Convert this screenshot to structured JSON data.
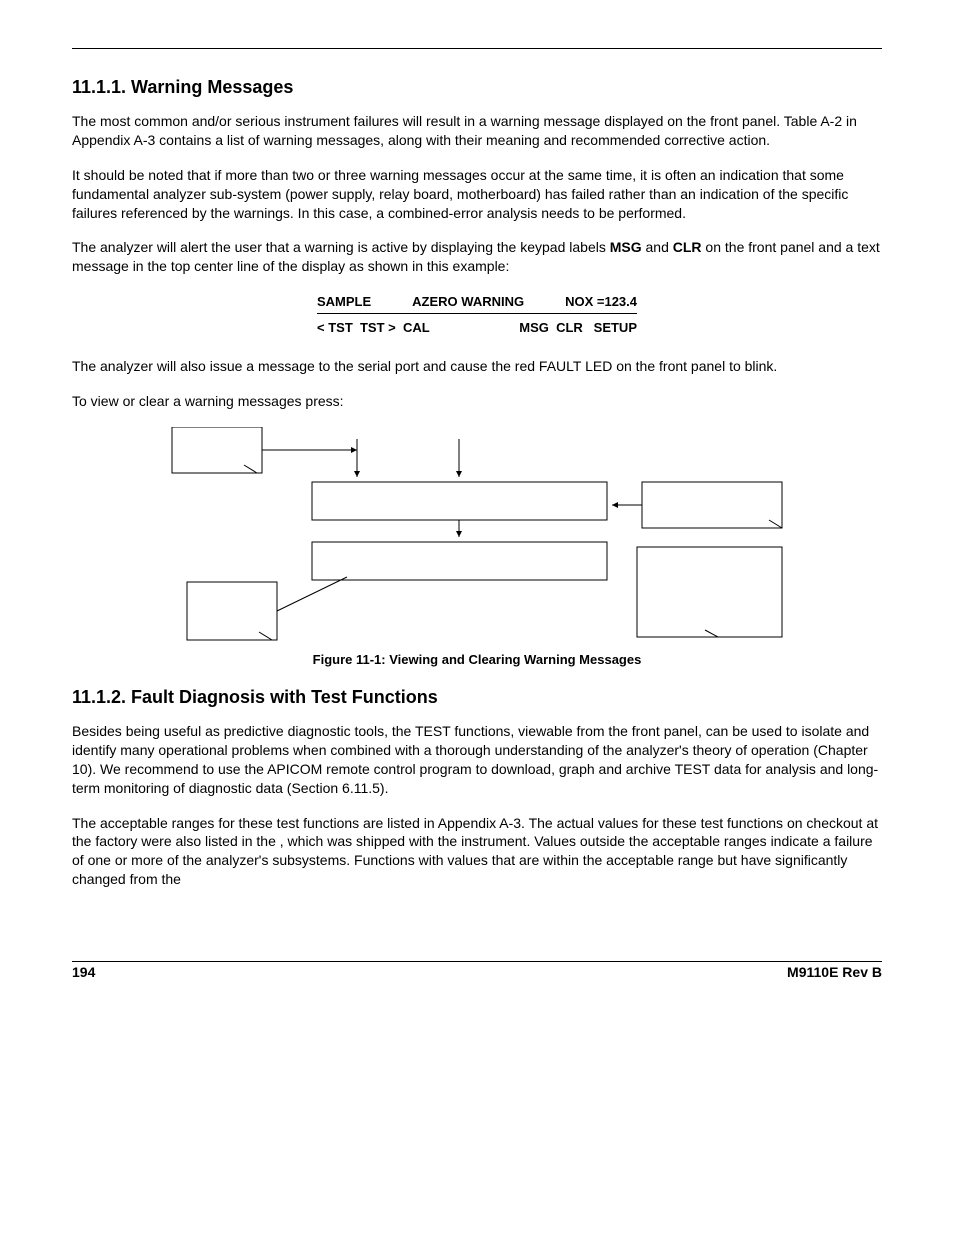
{
  "section1": {
    "heading": "11.1.1. Warning Messages",
    "p1": "The most common and/or serious instrument failures will result in a warning message displayed on the front panel. Table A-2 in Appendix A-3 contains a list of warning messages, along with their meaning and recommended corrective action.",
    "p2": "It should be noted that if more than two or three warning messages occur at the same time, it is often an indication that some fundamental analyzer sub-system (power supply, relay board, motherboard) has failed rather than an indication of the specific failures referenced by the warnings. In this case, a combined-error analysis needs to be performed.",
    "p3_pre": "The analyzer will alert the user that a warning is active by displaying the keypad labels ",
    "p3_b1": "MSG",
    "p3_mid": " and ",
    "p3_b2": "CLR",
    "p3_post": " on the front panel and a text message in the top center line of the display as shown in this example:"
  },
  "display": {
    "row1_left": "SAMPLE",
    "row1_center": "AZERO WARNING",
    "row1_right": "NOX =123.4",
    "row2_left": "< TST  TST >  CAL",
    "row2_right": "MSG  CLR   SETUP"
  },
  "afterdisplay": {
    "p1": "The analyzer will also issue a message to the serial port and cause the red FAULT LED on the front panel to blink.",
    "p2": "To view or clear a warning messages press:"
  },
  "figure_caption": "Figure 11-1: Viewing and Clearing Warning Messages",
  "section2": {
    "heading": "11.1.2. Fault Diagnosis with Test Functions",
    "p1": "Besides being useful as predictive diagnostic tools, the TEST functions, viewable from the front panel, can be used to isolate and identify many operational problems when combined with a thorough understanding of the analyzer's theory of operation (Chapter 10). We recommend to use the APICOM remote control program to download, graph and archive TEST data for analysis and long-term monitoring of diagnostic data (Section 6.11.5).",
    "p2": "The acceptable ranges for these test functions are listed in Appendix A-3. The actual values for these test functions on checkout at the factory were also listed in the                                          , which was shipped with the instrument. Values outside the acceptable ranges indicate a failure of one or more of the analyzer's subsystems. Functions with values that are within the acceptable range but have significantly changed from the"
  },
  "footer": {
    "page": "194",
    "doc": "M9110E Rev B"
  }
}
